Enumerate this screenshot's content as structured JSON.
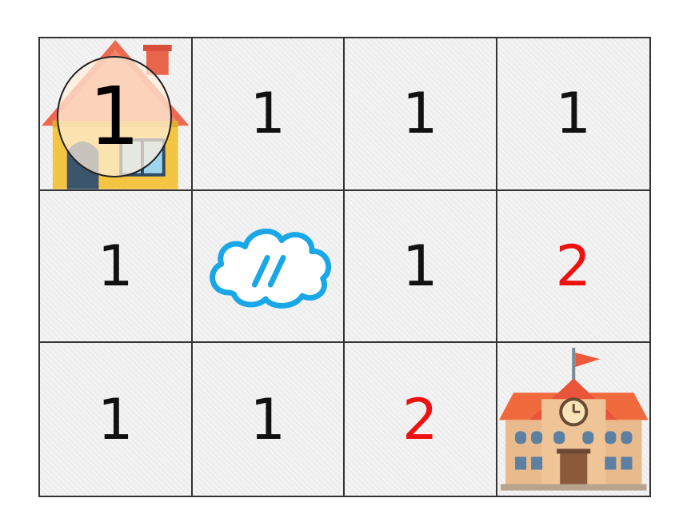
{
  "board": {
    "rows": 3,
    "cols": 4,
    "cells": [
      [
        {
          "value": "1",
          "color": "#111111",
          "icon": "house-icon"
        },
        {
          "value": "1",
          "color": "#111111"
        },
        {
          "value": "1",
          "color": "#111111"
        },
        {
          "value": "1",
          "color": "#111111"
        }
      ],
      [
        {
          "value": "1",
          "color": "#111111"
        },
        {
          "value": "",
          "icon": "cloud-icon"
        },
        {
          "value": "1",
          "color": "#111111"
        },
        {
          "value": "2",
          "color": "#ee1111"
        }
      ],
      [
        {
          "value": "1",
          "color": "#111111"
        },
        {
          "value": "1",
          "color": "#111111"
        },
        {
          "value": "2",
          "color": "#ee1111"
        },
        {
          "value": "",
          "icon": "school-icon"
        }
      ]
    ]
  },
  "token": {
    "value": "1"
  },
  "colors": {
    "grid_line": "#333333",
    "normal_number": "#111111",
    "cost_number": "#ee1111",
    "cloud": "#1aa7e8"
  }
}
